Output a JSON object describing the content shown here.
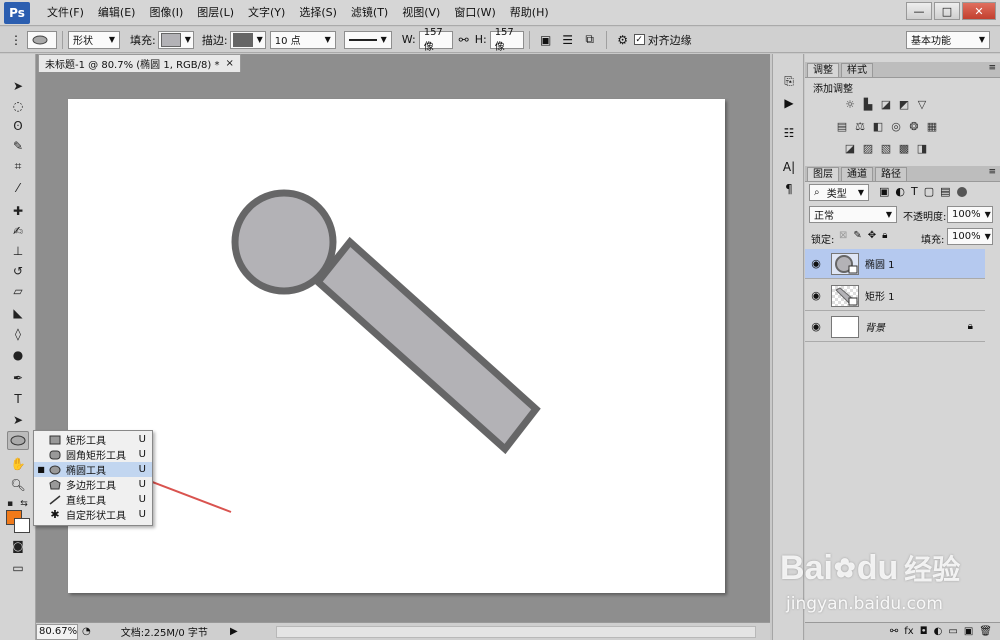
{
  "app": {
    "logo": "Ps"
  },
  "menu": [
    "文件(F)",
    "编辑(E)",
    "图像(I)",
    "图层(L)",
    "文字(Y)",
    "选择(S)",
    "滤镜(T)",
    "视图(V)",
    "窗口(W)",
    "帮助(H)"
  ],
  "window_controls": {
    "minimize": "—",
    "maximize": "□",
    "close": "✕"
  },
  "options_bar": {
    "mode": "形状",
    "fill_label": "填充:",
    "stroke_label": "描边:",
    "stroke_size": "10 点",
    "w_label": "W:",
    "w_value": "157 像",
    "h_label": "H:",
    "h_value": "157 像",
    "align_edges_label": "对齐边缘",
    "workspace": "基本功能",
    "fill_color": "#b3b2b6",
    "stroke_color": "#666666"
  },
  "document": {
    "tab_title": "未标题-1 @ 80.7% (椭圆 1, RGB/8) *",
    "tab_close": "×",
    "shape_fill": "#b3b2b6",
    "shape_stroke": "#666667"
  },
  "status": {
    "zoom": "80.67%",
    "doc_info": "文档:2.25M/0 字节"
  },
  "tool_flyout": {
    "items": [
      {
        "label": "矩形工具",
        "key": "U",
        "selected": false
      },
      {
        "label": "圆角矩形工具",
        "key": "U",
        "selected": false
      },
      {
        "label": "椭圆工具",
        "key": "U",
        "selected": true
      },
      {
        "label": "多边形工具",
        "key": "U",
        "selected": false
      },
      {
        "label": "直线工具",
        "key": "U",
        "selected": false
      },
      {
        "label": "自定形状工具",
        "key": "U",
        "selected": false
      }
    ],
    "bullet": "■"
  },
  "foreground_color": "#f07a1a",
  "adjustments_panel": {
    "tabs": [
      "调整",
      "样式"
    ],
    "title": "添加调整"
  },
  "layers_panel": {
    "tabs": [
      "图层",
      "通道",
      "路径"
    ],
    "filter_kind": "类型",
    "blend_mode": "正常",
    "opacity_label": "不透明度:",
    "opacity_value": "100%",
    "lock_label": "锁定:",
    "fill_label": "填充:",
    "fill_value": "100%",
    "layers": [
      {
        "name": "椭圆 1",
        "selected": true
      },
      {
        "name": "矩形 1",
        "selected": false
      },
      {
        "name": "背景",
        "selected": false,
        "locked": true
      }
    ],
    "bottom_icons": [
      "fx"
    ]
  },
  "watermark": {
    "brand": "Bai",
    "brand2": "du",
    "cn": "经验",
    "url": "jingyan.baidu.com"
  },
  "annotation_color": "#d9534f"
}
